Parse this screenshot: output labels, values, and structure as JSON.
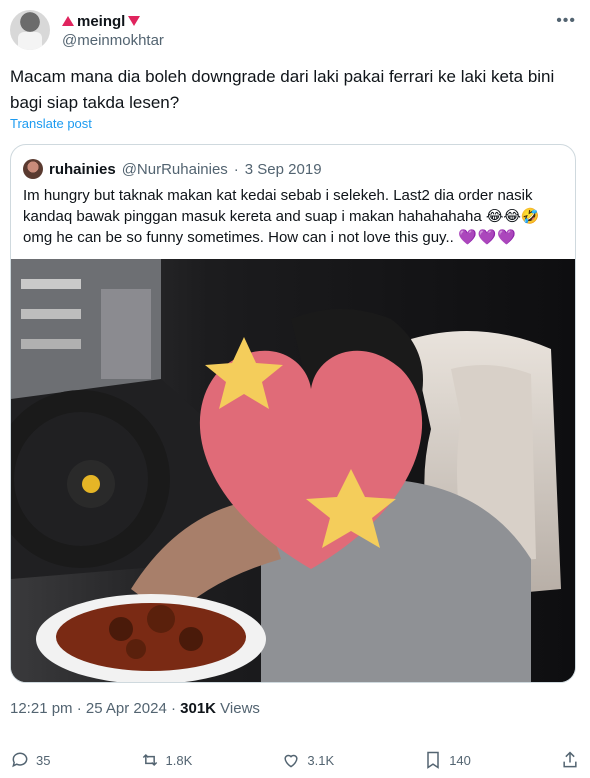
{
  "author": {
    "display_name": "meingl",
    "handle": "@meinmokhtar"
  },
  "tweet": {
    "text": "Macam mana dia boleh downgrade dari laki pakai ferrari ke laki keta bini bagi siap takda lesen?",
    "translate_label": "Translate post"
  },
  "quoted": {
    "display_name": "ruhainies",
    "handle": "@NurRuhainies",
    "separator": "·",
    "date": "3 Sep 2019",
    "text": "Im hungry but taknak makan kat kedai sebab i selekeh. Last2 dia order nasik kandaq bawak pinggan masuk kereta and suap i makan hahahahaha 😂😂🤣 omg he can be so funny sometimes. How can i not love this guy.. ",
    "hearts": "💜💜💜"
  },
  "meta": {
    "time": "12:21 pm",
    "sep1": "·",
    "date": "25 Apr 2024",
    "sep2": "·",
    "views_count": "301K",
    "views_label": " Views"
  },
  "actions": {
    "replies": "35",
    "reposts": "1.8K",
    "likes": "3.1K",
    "bookmarks": "140"
  },
  "colors": {
    "accent": "#1d9bf0",
    "muted": "#536471",
    "badge": "#e0245e",
    "heart_sticker": "#e06b78",
    "star_sticker": "#f4cd5b"
  },
  "icons": {
    "more": "more-icon",
    "reply": "reply-icon",
    "repost": "repost-icon",
    "like": "like-icon",
    "bookmark": "bookmark-icon",
    "share": "share-icon"
  }
}
